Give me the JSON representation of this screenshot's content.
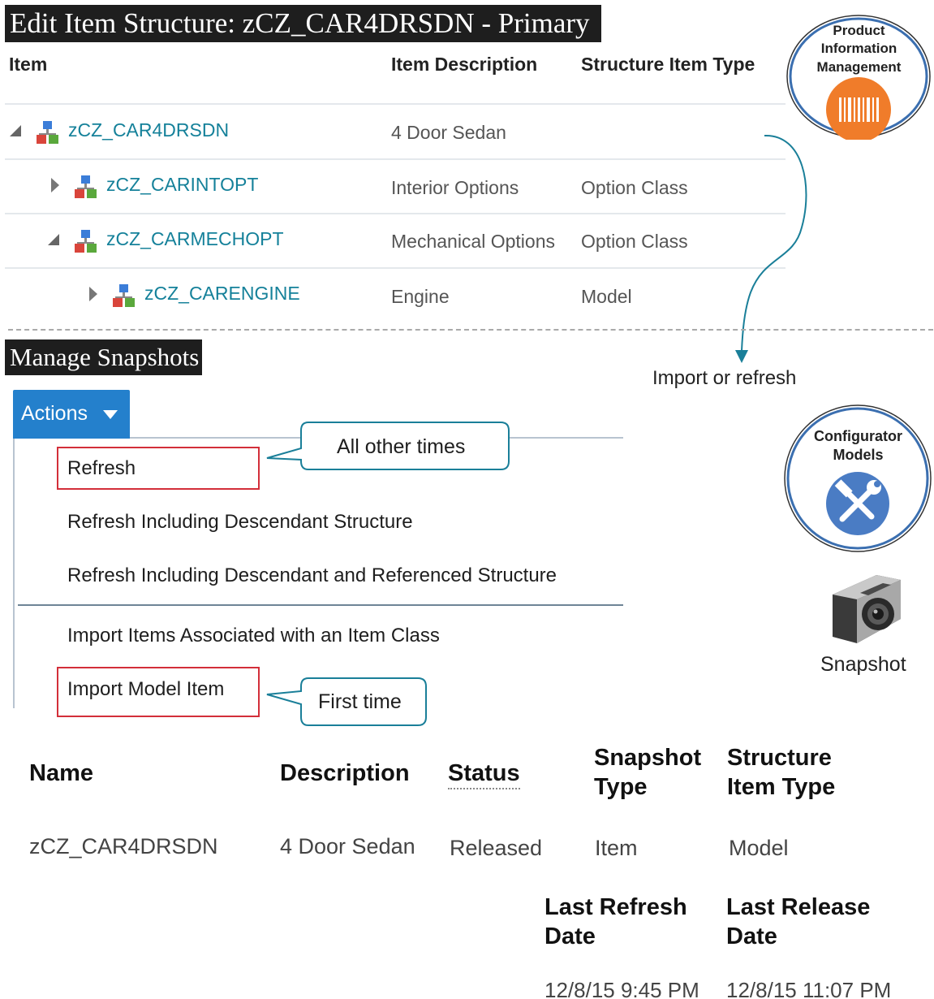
{
  "page_title": "Edit Item Structure: zCZ_CAR4DRSDN - Primary",
  "tree_table": {
    "headers": {
      "item": "Item",
      "description": "Item Description",
      "type": "Structure Item Type"
    },
    "rows": [
      {
        "name": "zCZ_CAR4DRSDN",
        "description": "4 Door Sedan",
        "type": ""
      },
      {
        "name": "zCZ_CARINTOPT",
        "description": "Interior Options",
        "type": "Option Class"
      },
      {
        "name": "zCZ_CARMECHOPT",
        "description": "Mechanical Options",
        "type": "Option Class"
      },
      {
        "name": "zCZ_CARENGINE",
        "description": "Engine",
        "type": "Model"
      }
    ]
  },
  "badges": {
    "pim": {
      "line1": "Product",
      "line2": "Information",
      "line3": "Management",
      "icon": "barcode-icon",
      "color": "#f07c2a"
    },
    "configurator": {
      "line1": "Configurator",
      "line2": "Models",
      "icon": "tools-icon",
      "color": "#4a7cc4"
    }
  },
  "flow_label": "Import or refresh",
  "snapshot_label": "Snapshot",
  "section_title": "Manage Snapshots",
  "actions": {
    "label": "Actions",
    "items": [
      "Refresh",
      "Refresh Including Descendant Structure",
      "Refresh Including Descendant and Referenced Structure",
      "Import Items Associated with an Item Class",
      "Import Model Item"
    ]
  },
  "callouts": {
    "refresh": "All other times",
    "import": "First time"
  },
  "snapshot_table": {
    "headers": {
      "name": "Name",
      "description": "Description",
      "status": "Status",
      "snapshot_type_1": "Snapshot",
      "snapshot_type_2": "Type",
      "structure_type_1": "Structure",
      "structure_type_2": "Item Type",
      "last_refresh_1": "Last Refresh",
      "last_refresh_2": "Date",
      "last_release_1": "Last Release",
      "last_release_2": "Date"
    },
    "row": {
      "name": "zCZ_CAR4DRSDN",
      "description": "4 Door Sedan",
      "status": "Released",
      "snapshot_type": "Item",
      "structure_type": "Model",
      "last_refresh": "12/8/15 9:45 PM",
      "last_release": "12/8/15 11:07 PM"
    }
  },
  "colors": {
    "link": "#15819a",
    "accent_blue": "#2480cc",
    "highlight_red": "#d32f3a",
    "callout_teal": "#1a7f99"
  }
}
